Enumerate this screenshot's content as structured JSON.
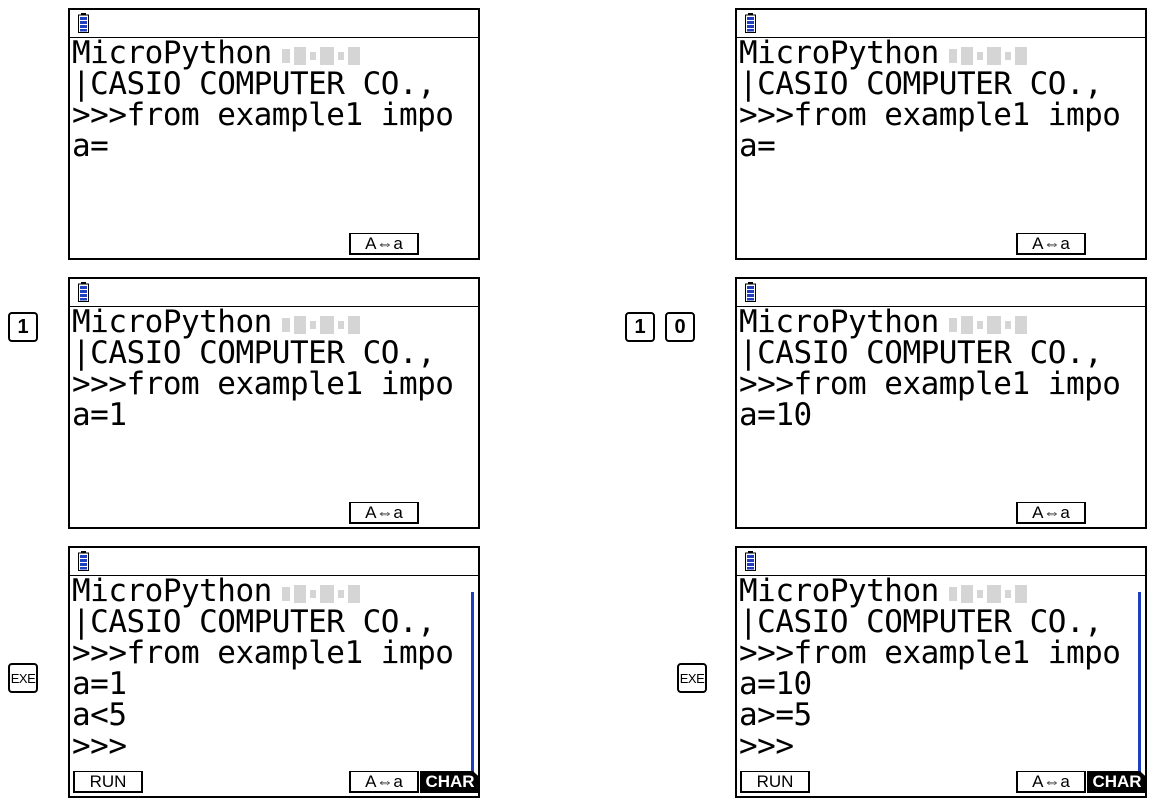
{
  "screens": [
    {
      "id": "s1",
      "lines": [
        "MicroPython",
        "|CASIO COMPUTER CO.,",
        ">>>from example1 impo",
        "a="
      ],
      "softkeys": {
        "case": "A⇔a"
      }
    },
    {
      "id": "s2",
      "lines": [
        "MicroPython",
        "|CASIO COMPUTER CO.,",
        ">>>from example1 impo",
        "a="
      ],
      "softkeys": {
        "case": "A⇔a"
      }
    },
    {
      "id": "s3",
      "keys": [
        "1"
      ],
      "lines": [
        "MicroPython",
        "|CASIO COMPUTER CO.,",
        ">>>from example1 impo",
        "a=1"
      ],
      "softkeys": {
        "case": "A⇔a"
      }
    },
    {
      "id": "s4",
      "keys": [
        "1",
        "0"
      ],
      "lines": [
        "MicroPython",
        "|CASIO COMPUTER CO.,",
        ">>>from example1 impo",
        "a=10"
      ],
      "softkeys": {
        "case": "A⇔a"
      }
    },
    {
      "id": "s5",
      "keys": [
        "EXE"
      ],
      "lines": [
        "MicroPython",
        "|CASIO COMPUTER CO.,",
        ">>>from example1 impo",
        "a=1",
        "a<5",
        ">>>"
      ],
      "softkeys": {
        "run": "RUN",
        "case": "A⇔a",
        "char": "CHAR"
      }
    },
    {
      "id": "s6",
      "keys": [
        "EXE"
      ],
      "lines": [
        "MicroPython",
        "|CASIO COMPUTER CO.,",
        ">>>from example1 impo",
        "a=10",
        "a>=5",
        ">>>"
      ],
      "softkeys": {
        "run": "RUN",
        "case": "A⇔a",
        "char": "CHAR"
      }
    }
  ],
  "colors": {
    "battery": "#1f3fbf",
    "scrollbar": "#1f3fbf",
    "frame": "#000000"
  },
  "icons": {
    "battery": "battery-icon"
  }
}
